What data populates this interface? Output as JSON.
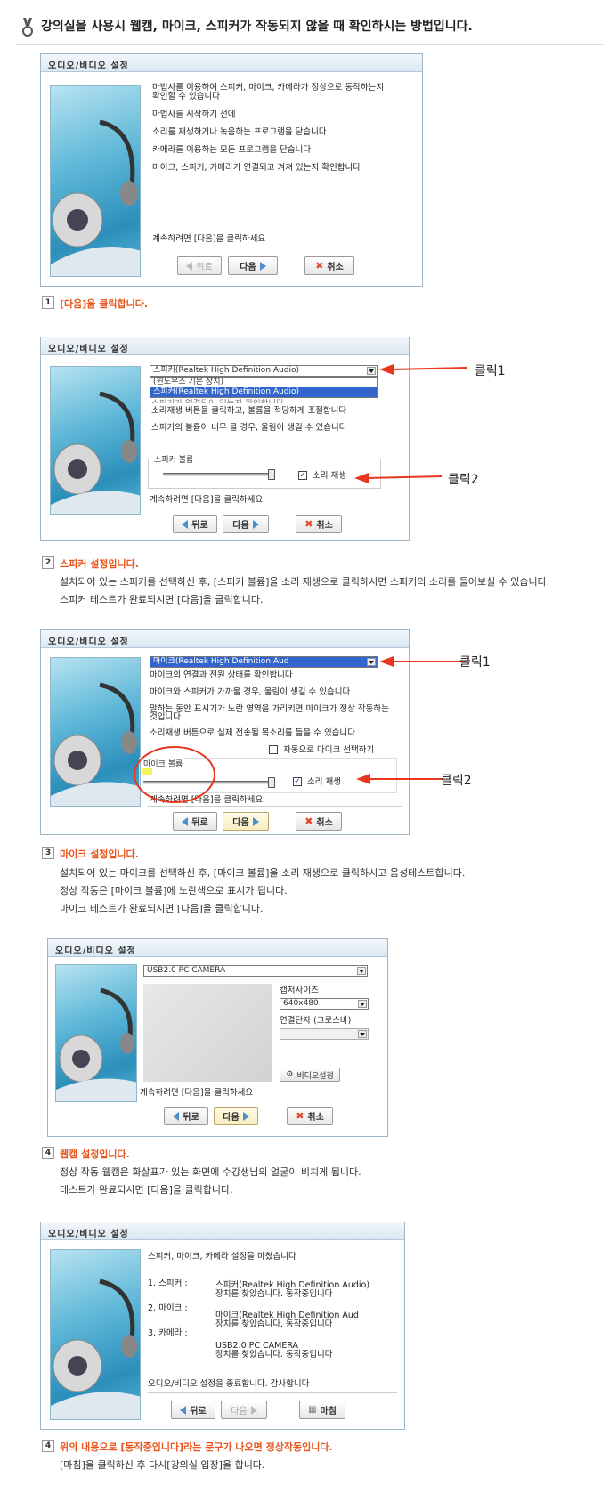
{
  "header": {
    "title": "강의실을 사용시 웹캠, 마이크, 스피커가 작동되지 않을 때 확인하시는 방법입니다."
  },
  "dialog_title": "오디오/비디오 설정",
  "buttons": {
    "back": "뒤로",
    "next": "다음",
    "cancel": "취소",
    "finish": "마침"
  },
  "click_labels": {
    "c1": "클릭1",
    "c2": "클릭2"
  },
  "step1": {
    "lines": [
      "마법사를 이용하여 스피커, 마이크, 카메라가 정상으로 동작하는지",
      "확인할 수 있습니다",
      "마법사를 시작하기 전에",
      "소리를 재생하거나 녹음하는 프로그램을 닫습니다",
      "카메라를 이용하는 모든 프로그램을 닫습니다",
      "마이크, 스피커, 카메라가 연결되고 켜져 있는지 확인합니다"
    ],
    "continue": "계속하려면 [다음]을 클릭하세요",
    "num": "1",
    "caption": "[다음]을 클릭합니다."
  },
  "step2": {
    "select_value": "스피커(Realtek High Definition Audio)",
    "options": [
      "(윈도우즈 기본 장치)",
      "스피커(Realtek High Definition Audio)"
    ],
    "line_hidden": "스피커가 연결되어 있는지 확인합니다",
    "lines": [
      "소리재생 버튼을 클릭하고, 볼륨을 적당하게 조절합니다",
      "스피커의 볼륨이 너무 클 경우, 울림이 생길 수 있습니다"
    ],
    "group_label": "스피커 볼륨",
    "play_label": "소리 재생",
    "continue": "계속하려면 [다음]을 클릭하세요",
    "num": "2",
    "caption": "스피커 설정입니다.",
    "desc": [
      "설치되어 있는 스피커를 선택하신 후, [스피커 볼륨]을 소리 재생으로 클릭하시면 스피커의 소리를 들어보실 수 있습니다.",
      "스피커 테스트가 완료되시면 [다음]을 클릭합니다."
    ]
  },
  "step3": {
    "select_value": "마이크(Realtek High Definition Aud",
    "lines": [
      "마이크의 연결과 전원 상태를 확인합니다",
      "마이크와 스피커가 가까울 경우, 울림이 생길 수 있습니다",
      "말하는 동안 표시기가 노란 영역을 가리키면 마이크가 정상 작동하는",
      "것입니다",
      "소리재생 버튼으로 실제 전송될 목소리를 들을 수 있습니다"
    ],
    "auto_label": "자동으로 마이크 선택하기",
    "group_label": "마이크 볼륨",
    "play_label": "소리 재생",
    "continue": "계속하려면 [다음]을 클릭하세요",
    "num": "3",
    "caption": "마이크 설정입니다.",
    "desc": [
      "설치되어 있는 마이크를 선택하신 후, [마이크 볼륨]을 소리 재생으로 클릭하시고 음성테스트합니다.",
      "정상 작동은 [마이크 볼륨]에 노란색으로 표시가 됩니다.",
      "마이크 테스트가 완료되시면 [다음]을 클릭합니다."
    ]
  },
  "step4": {
    "select_value": "USB2.0 PC CAMERA",
    "capture_label": "캡처사이즈",
    "capture_value": "640x480",
    "connector_label": "연결단자 (크로스바)",
    "video_settings": "비디오설정",
    "continue": "계속하려면 [다음]을 클릭하세요",
    "num": "4",
    "caption": "웹캠 설정입니다.",
    "desc": [
      "정상 작동 웹캠은 화살표가 있는 화면에 수강생님의 얼굴이 비치게 됩니다.",
      "테스트가 완료되시면 [다음]을 클릭합니다."
    ]
  },
  "step5": {
    "heading": "스피커, 마이크, 카메라 설정을 마쳤습니다",
    "items": [
      {
        "label": "1. 스피커 :",
        "dev": "스피커(Realtek High Definition Audio)",
        "status": "장치를 찾았습니다. 동작중입니다"
      },
      {
        "label": "2. 마이크 :",
        "dev": "마이크(Realtek High Definition Aud",
        "status": "장치를 찾았습니다. 동작중입니다"
      },
      {
        "label": "3. 카메라 :",
        "dev": "USB2.0 PC CAMERA",
        "status": "장치를 찾았습니다. 동작중입니다"
      }
    ],
    "footer": "오디오/비디오 설정을 종료합니다. 감사합니다",
    "num": "4",
    "caption": "위의 내용으로 [동작중입니다]라는 문구가 나오면 정상작동입니다.",
    "desc": [
      "[마침]을 클릭하신 후 다시[강의실 입장]을 합니다."
    ]
  }
}
